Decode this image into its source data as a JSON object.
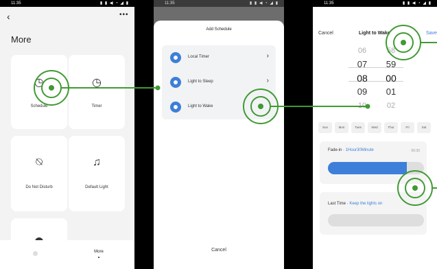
{
  "status_bar": {
    "time": "11:35",
    "icons": "▮ ▮ ◀ ◔ ◢ ▮"
  },
  "screen1": {
    "title": "More",
    "tiles": [
      {
        "label": "Schedule",
        "icon": "clock-icon"
      },
      {
        "label": "Timer",
        "icon": "timer-icon"
      },
      {
        "label": "Do Not Disturb",
        "icon": "bell-off-icon"
      },
      {
        "label": "Default Light",
        "icon": "bell-icon"
      }
    ],
    "tab_more": "More"
  },
  "screen2": {
    "title": "Add Schedule",
    "options": [
      "Local Timer",
      "Light to Sleep",
      "Light to Wake"
    ],
    "cancel": "Cancel"
  },
  "screen3": {
    "cancel": "Cancel",
    "title": "Light to Wake",
    "save": "Save",
    "hours": [
      "06",
      "07",
      "08",
      "09",
      "10"
    ],
    "minutes": [
      "58",
      "59",
      "00",
      "01",
      "02"
    ],
    "days": [
      "Sun",
      "Mon",
      "Tues",
      "Wed",
      "Thur",
      "Fri",
      "Sat"
    ],
    "fade_label": "Fade-in · ",
    "fade_value": "1Hour30Minute",
    "fade_time": "06:30",
    "fade_fraction": 0.82,
    "last_label": "Last Time · ",
    "last_value": "Keep the lights on"
  },
  "colors": {
    "accent": "#3d7fd9",
    "annotation": "#3f9a32"
  }
}
